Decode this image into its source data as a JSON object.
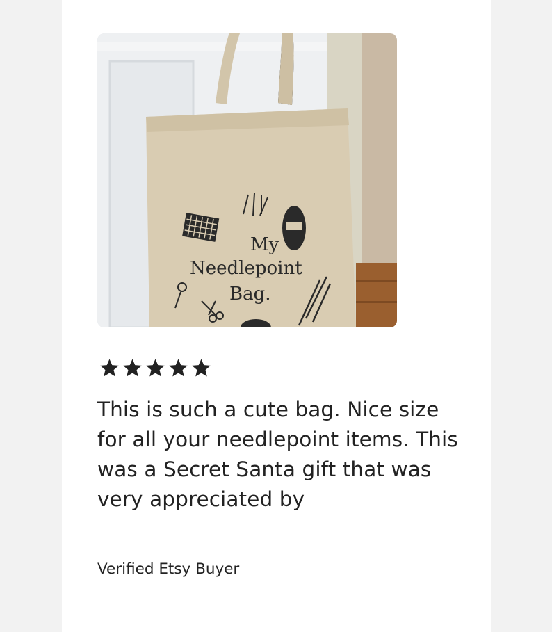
{
  "review": {
    "photo": {
      "icon": "tote-bag-photo",
      "bag_print_line1": "My",
      "bag_print_line2": "Needlepoint",
      "bag_print_line3": "Bag."
    },
    "rating": {
      "value": 5,
      "max": 5,
      "color": "#222222"
    },
    "text": "This is such a cute bag. Nice size for all your needlepoint items. This was a Secret Santa gift that was very appreciated by",
    "author": "Verified Etsy Buyer"
  },
  "colors": {
    "page_bg": "#f2f2f2",
    "card_bg": "#ffffff",
    "text": "#222222"
  }
}
